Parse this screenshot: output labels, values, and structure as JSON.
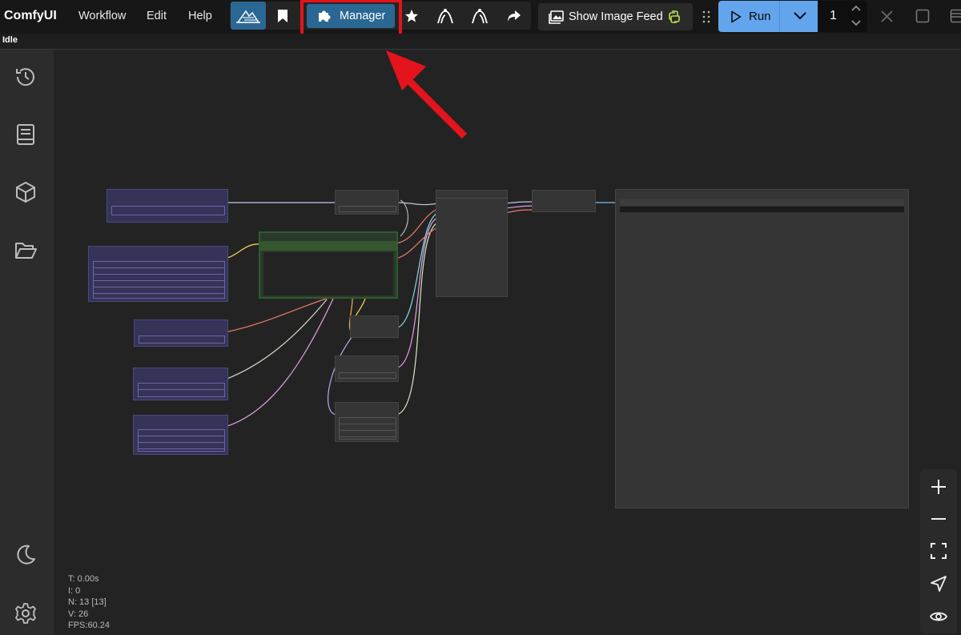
{
  "app": {
    "title": "ComfyUI"
  },
  "menu": {
    "items": [
      "Workflow",
      "Edit",
      "Help"
    ]
  },
  "toolbar": {
    "manager_label": "Manager",
    "show_image_feed_label": "Show Image Feed",
    "run_label": "Run",
    "batch_count": "1"
  },
  "status": {
    "text": "Idle"
  },
  "stats": {
    "lines": [
      "T: 0.00s",
      "I: 0",
      "N: 13 [13]",
      "V: 26",
      "FPS:60.24"
    ]
  },
  "colors": {
    "accent_blue": "#2b6793",
    "run_blue": "#63a5ec",
    "highlight_red": "#e3141b",
    "node_purple": "#353357",
    "node_gray": "#353535",
    "node_green": "#2a3a2a"
  },
  "icons": {
    "sidebar": [
      "history-icon",
      "book-icon",
      "cube-icon",
      "folder-icon",
      "moon-icon",
      "gear-icon"
    ],
    "zoom": [
      "zoom-in-icon",
      "zoom-out-icon",
      "fit-view-icon",
      "locate-icon",
      "eye-icon"
    ]
  }
}
